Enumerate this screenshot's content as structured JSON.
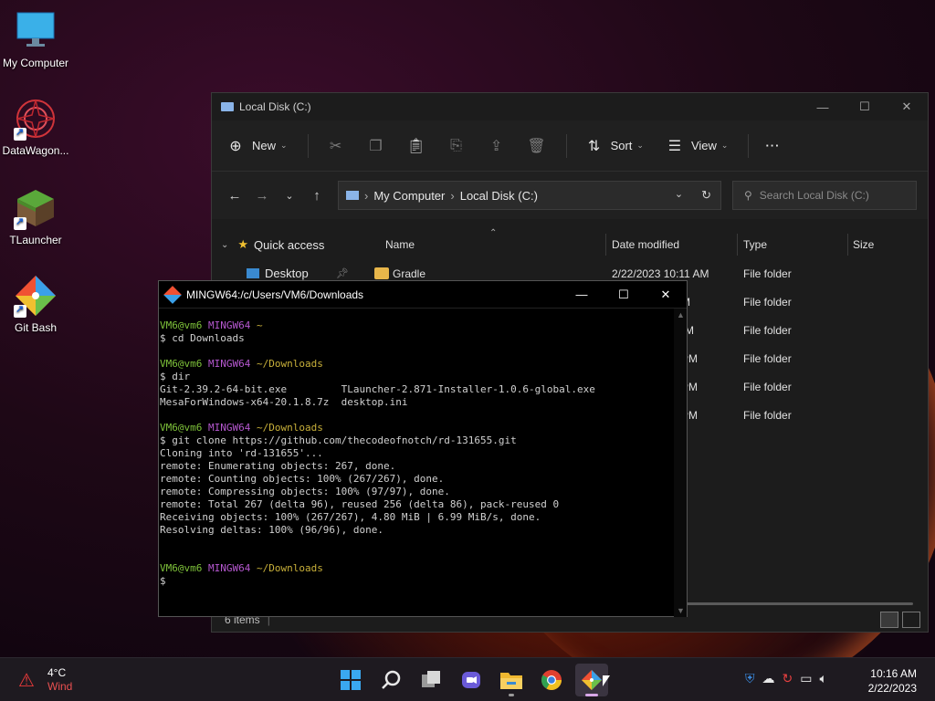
{
  "desktop": {
    "icons": [
      {
        "label": "My Computer",
        "icon": "monitor-icon"
      },
      {
        "label": "DataWagon...",
        "icon": "datawagon-icon"
      },
      {
        "label": "TLauncher",
        "icon": "grass-block-icon"
      },
      {
        "label": "Git Bash",
        "icon": "git-bash-icon"
      }
    ]
  },
  "explorer": {
    "title": "Local Disk (C:)",
    "toolbar": {
      "new_label": "New",
      "sort_label": "Sort",
      "view_label": "View",
      "more_label": "···"
    },
    "address": {
      "segments": [
        "My Computer",
        "Local Disk (C:)"
      ]
    },
    "search_placeholder": "Search Local Disk (C:)",
    "nav": {
      "quick_access": "Quick access",
      "desktop": "Desktop"
    },
    "columns": {
      "name": "Name",
      "date": "Date modified",
      "type": "Type",
      "size": "Size"
    },
    "rows": [
      {
        "name": "Gradle",
        "date": "2/22/2023 10:11 AM",
        "type": "File folder"
      },
      {
        "name": "",
        "date": "M",
        "type": "File folder"
      },
      {
        "name": "",
        "date": "AM",
        "type": "File folder"
      },
      {
        "name": "",
        "date": "PM",
        "type": "File folder"
      },
      {
        "name": "",
        "date": "PM",
        "type": "File folder"
      },
      {
        "name": "",
        "date": "PM",
        "type": "File folder"
      }
    ],
    "status": "6 items"
  },
  "terminal": {
    "title": "MINGW64:/c/Users/VM6/Downloads",
    "prompt_user": "VM6@vm6",
    "prompt_env": "MINGW64",
    "blocks": [
      {
        "path": "~",
        "command": "$ cd Downloads",
        "output": ""
      },
      {
        "path": "~/Downloads",
        "command": "$ dir",
        "output": "Git-2.39.2-64-bit.exe         TLauncher-2.871-Installer-1.0.6-global.exe\nMesaForWindows-x64-20.1.8.7z  desktop.ini"
      },
      {
        "path": "~/Downloads",
        "command": "$ git clone https://github.com/thecodeofnotch/rd-131655.git",
        "output": "Cloning into 'rd-131655'...\nremote: Enumerating objects: 267, done.\nremote: Counting objects: 100% (267/267), done.\nremote: Compressing objects: 100% (97/97), done.\nremote: Total 267 (delta 96), reused 256 (delta 86), pack-reused 0\nReceiving objects: 100% (267/267), 4.80 MiB | 6.99 MiB/s, done.\nResolving deltas: 100% (96/96), done."
      },
      {
        "path": "~/Downloads",
        "command": "$",
        "output": ""
      }
    ]
  },
  "taskbar": {
    "weather": {
      "temp": "4°C",
      "condition": "Wind"
    },
    "apps": [
      "windows-start-icon",
      "search-icon",
      "task-view-icon",
      "chat-icon",
      "file-explorer-icon",
      "chrome-icon",
      "git-bash-icon"
    ],
    "time": "10:16 AM",
    "date": "2/22/2023"
  },
  "colors": {
    "accent": "#7ec23a",
    "prompt_env": "#b658d0",
    "path": "#c8b03a",
    "folder": "#e8b64a"
  }
}
